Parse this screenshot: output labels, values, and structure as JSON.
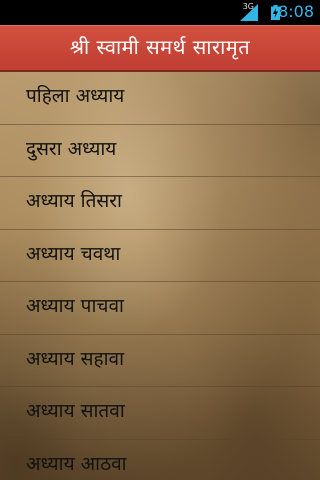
{
  "status_bar": {
    "network_type": "3G",
    "time": "8:08",
    "accent_color": "#33b5e5"
  },
  "title_bar": {
    "title": "श्री  स्वामी  समर्थ  सारामृत",
    "background_color": "#c9463a"
  },
  "chapters": [
    {
      "label": "पहिला अध्याय"
    },
    {
      "label": " दुसरा अध्याय"
    },
    {
      "label": "अध्याय तिसरा"
    },
    {
      "label": "अध्याय चवथा"
    },
    {
      "label": " अध्याय पाचवा"
    },
    {
      "label": "अध्याय सहावा"
    },
    {
      "label": "अध्याय सातवा"
    },
    {
      "label": "अध्याय आठवा"
    }
  ]
}
